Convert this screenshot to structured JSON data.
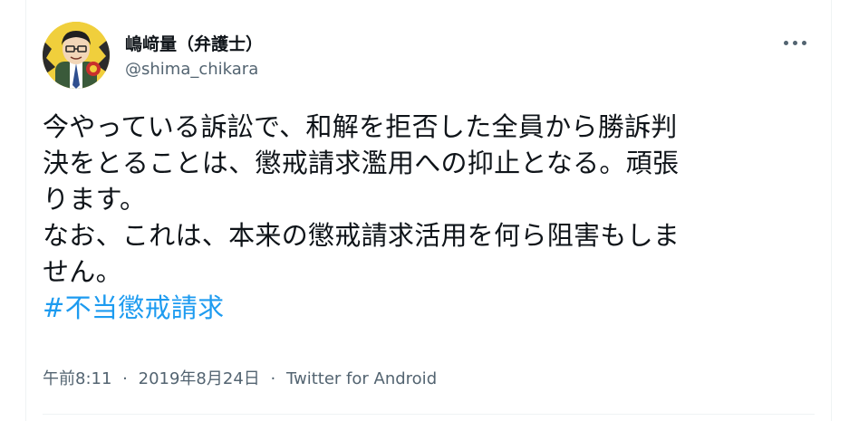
{
  "author": {
    "display_name": "嶋﨑量（弁護士）",
    "handle": "@shima_chikara"
  },
  "more_icon": "more-horizontal-icon",
  "tweet": {
    "lines": [
      "今やっている訴訟で、和解を拒否した全員から勝訴判",
      "決をとることは、懲戒請求濫用への抑止となる。頑張",
      "ります。",
      "なお、これは、本来の懲戒請求活用を何ら阻害もしま",
      "せん。"
    ],
    "hashtag": "#不当懲戒請求"
  },
  "meta": {
    "time": "午前8:11",
    "separator_1": "·",
    "date": "2019年8月24日",
    "separator_2": "·",
    "source": "Twitter for Android"
  },
  "colors": {
    "text": "#0f1419",
    "secondary": "#536471",
    "link": "#1d9bf0",
    "border": "#eff3f4"
  }
}
